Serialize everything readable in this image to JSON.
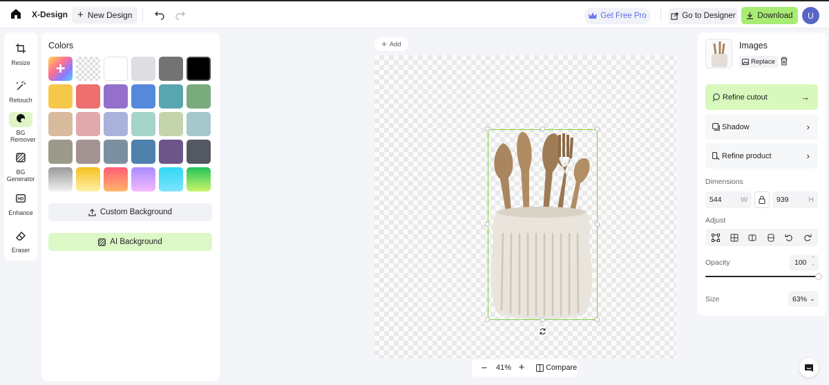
{
  "header": {
    "brand": "X-Design",
    "new_design_label": "New Design",
    "get_pro_label": "Get Free Pro",
    "go_designer_label": "Go to Designer",
    "download_label": "Download",
    "avatar_initial": "U"
  },
  "rail": {
    "items": [
      {
        "label": "Resize",
        "icon": "crop-icon"
      },
      {
        "label": "Retouch",
        "icon": "magic-wand-icon"
      },
      {
        "label": "BG Remover",
        "icon": "bg-remover-icon",
        "active": true
      },
      {
        "label": "BG Generator",
        "icon": "hatch-icon"
      },
      {
        "label": "Enhance",
        "icon": "hd-icon"
      },
      {
        "label": "Eraser",
        "icon": "eraser-icon"
      }
    ]
  },
  "colors_panel": {
    "title": "Colors",
    "swatches": [
      "rainbow-add",
      "transparent",
      "#ffffff",
      "#dddee1",
      "#737373",
      "#000000",
      "#f6c84a",
      "#ed6f6e",
      "#9470cc",
      "#5589dc",
      "#5aa6b0",
      "#79ab7c",
      "#d8bb9d",
      "#e0a9ac",
      "#a8b2da",
      "#a5d4c9",
      "#c4d4ab",
      "#a5c8cb",
      "#9c9a8a",
      "#a39392",
      "#7b8fa0",
      "#5080ac",
      "#6b5589",
      "#545862",
      "gradient-gray",
      "gradient-gold",
      "gradient-coral",
      "gradient-violet",
      "gradient-cyan",
      "gradient-green"
    ],
    "custom_bg_label": "Custom Background",
    "ai_bg_label": "AI Background"
  },
  "canvas": {
    "add_label": "Add",
    "zoom": "41%",
    "compare_label": "Compare"
  },
  "properties": {
    "title": "Images",
    "replace_label": "Replace",
    "refine_cutout_label": "Refine cutout",
    "shadow_label": "Shadow",
    "refine_product_label": "Refine product",
    "dimensions_label": "Dimensions",
    "width": "544",
    "width_unit": "W",
    "height": "939",
    "height_unit": "H",
    "adjust_label": "Adjust",
    "opacity_label": "Opacity",
    "opacity_value": "100",
    "size_label": "Size",
    "size_value": "63%"
  },
  "colors": {
    "accent_green": "#a9ec73",
    "pro_blue": "#5a6cf0",
    "avatar": "#5964c8"
  }
}
